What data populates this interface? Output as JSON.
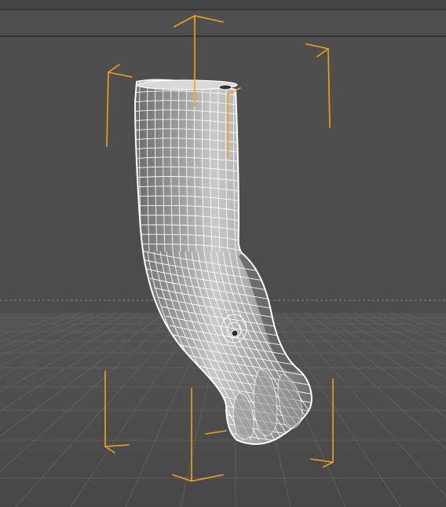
{
  "viewport": {
    "view": "perspective",
    "object": "arm-mesh",
    "display": "wireframe-on-shaded",
    "colors": {
      "background": "#4d4d4d",
      "floor": "#4a4a4a",
      "grid": "#5e5e5e",
      "grid_major": "#6a6a6a",
      "horizon": "#8c8c8c",
      "wire": "#ffffff",
      "selection_brackets": "#f5a623",
      "frame_lines": "#2a2a2a"
    }
  },
  "icons": {
    "selection": "bounding-box-corner-brackets"
  }
}
